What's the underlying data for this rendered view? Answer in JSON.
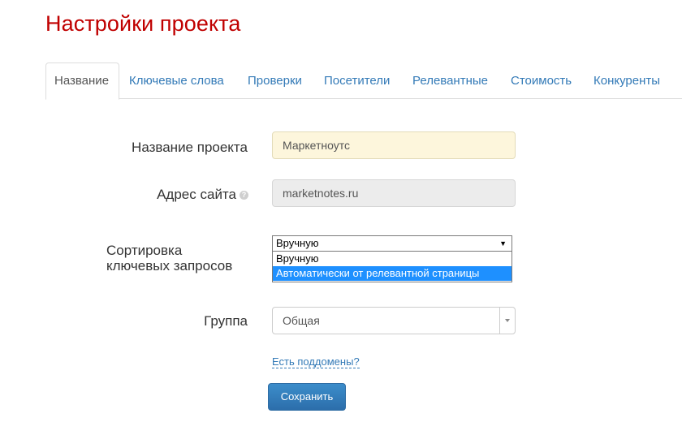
{
  "page_title": "Настройки проекта",
  "tabs": [
    {
      "label": "Название",
      "active": true
    },
    {
      "label": "Ключевые слова",
      "active": false
    },
    {
      "label": "Проверки",
      "active": false
    },
    {
      "label": "Посетители",
      "active": false
    },
    {
      "label": "Релевантные",
      "active": false
    },
    {
      "label": "Стоимость",
      "active": false
    },
    {
      "label": "Конкуренты",
      "active": false
    }
  ],
  "form": {
    "project_name": {
      "label": "Название проекта",
      "value": "Маркетноутс"
    },
    "site_address": {
      "label": "Адрес сайта",
      "value": "marketnotes.ru",
      "help_icon": "question-icon"
    },
    "sorting": {
      "label_line1": "Сортировка",
      "label_line2": "ключевых запросов",
      "selected": "Вручную",
      "options": [
        "Вручную",
        "Автоматически от релевантной страницы"
      ],
      "highlighted_option": "Автоматически от релевантной страницы"
    },
    "group": {
      "label": "Группа",
      "value": "Общая"
    },
    "subdomains_link": "Есть поддомены?",
    "save_label": "Сохранить"
  },
  "colors": {
    "title": "#c00000",
    "link": "#337ab7",
    "name_input_bg": "#fdf6dc",
    "site_input_bg": "#ececec",
    "dropdown_highlight": "#1e90ff",
    "button": "#2c6eab"
  }
}
